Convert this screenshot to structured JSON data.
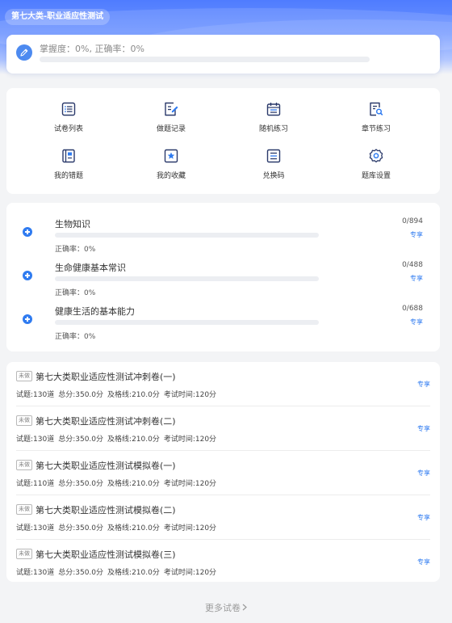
{
  "header": {
    "title": "第七大类-职业适应性测试"
  },
  "progress": {
    "text": "掌握度：0%, 正确率：0%",
    "mastery_fraction": 0,
    "icon": "pencil-icon"
  },
  "menu": [
    {
      "label": "试卷列表",
      "icon": "list-icon"
    },
    {
      "label": "做题记录",
      "icon": "edit-record-icon"
    },
    {
      "label": "随机练习",
      "icon": "calendar-icon"
    },
    {
      "label": "章节练习",
      "icon": "search-doc-icon"
    },
    {
      "label": "我的错题",
      "icon": "book-icon"
    },
    {
      "label": "我的收藏",
      "icon": "star-icon"
    },
    {
      "label": "兑换码",
      "icon": "code-list-icon"
    },
    {
      "label": "题库设置",
      "icon": "gear-icon"
    }
  ],
  "topics": [
    {
      "name": "生物知识",
      "count": "0/894",
      "rate": "正确率：0%",
      "link": "专享",
      "progress": 0
    },
    {
      "name": "生命健康基本常识",
      "count": "0/488",
      "rate": "正确率：0%",
      "link": "专享",
      "progress": 0
    },
    {
      "name": "健康生活的基本能力",
      "count": "0/688",
      "rate": "正确率：0%",
      "link": "专享",
      "progress": 0
    }
  ],
  "papers": [
    {
      "tag": "未做",
      "title": "第七大类职业适应性测试冲刺卷(一)",
      "questions": "试题:130道",
      "score": "总分:350.0分",
      "pass": "及格线:210.0分",
      "time": "考试时间:120分",
      "link": "专享"
    },
    {
      "tag": "未做",
      "title": "第七大类职业适应性测试冲刺卷(二)",
      "questions": "试题:130道",
      "score": "总分:350.0分",
      "pass": "及格线:210.0分",
      "time": "考试时间:120分",
      "link": "专享"
    },
    {
      "tag": "未做",
      "title": "第七大类职业适应性测试模拟卷(一)",
      "questions": "试题:110道",
      "score": "总分:350.0分",
      "pass": "及格线:210.0分",
      "time": "考试时间:120分",
      "link": "专享"
    },
    {
      "tag": "未做",
      "title": "第七大类职业适应性测试模拟卷(二)",
      "questions": "试题:130道",
      "score": "总分:350.0分",
      "pass": "及格线:210.0分",
      "time": "考试时间:120分",
      "link": "专享"
    },
    {
      "tag": "未做",
      "title": "第七大类职业适应性测试模拟卷(三)",
      "questions": "试题:130道",
      "score": "总分:350.0分",
      "pass": "及格线:210.0分",
      "time": "考试时间:120分",
      "link": "专享"
    }
  ],
  "more_label": "更多试卷",
  "colors": {
    "accent": "#2f7bf0",
    "icon_stroke": "#2b3a6b"
  }
}
